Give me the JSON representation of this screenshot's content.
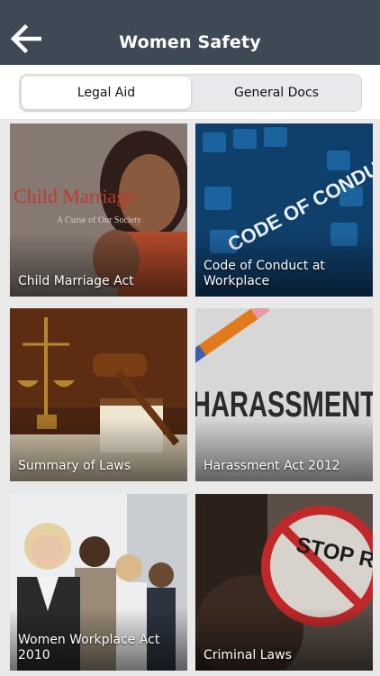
{
  "header": {
    "title": "Women Safety",
    "back_icon": "arrow-left-icon",
    "background": "#3d4a55"
  },
  "tabs": [
    {
      "label": "Legal Aid",
      "selected": true
    },
    {
      "label": "General Docs",
      "selected": false
    }
  ],
  "cards": [
    {
      "label": "Child Marriage Act",
      "image_text": "Child Marriage",
      "image_subtext": "A Curse of Our Society"
    },
    {
      "label": "Code of Conduct at Workplace",
      "image_text": "CODE OF CONDUCT"
    },
    {
      "label": "Summary of Laws"
    },
    {
      "label": "Harassment Act 2012",
      "image_text": "HARASSMENT"
    },
    {
      "label": "Women Workplace Act 2010"
    },
    {
      "label": "Criminal Laws",
      "image_text": "STOP RAPE"
    }
  ]
}
